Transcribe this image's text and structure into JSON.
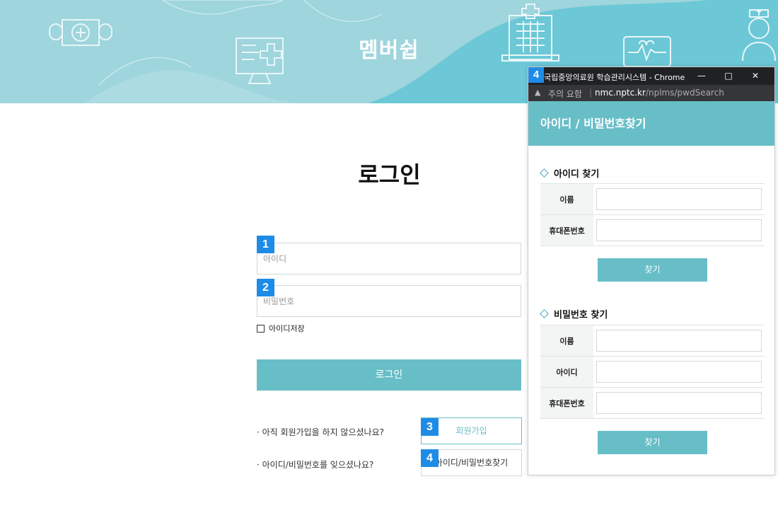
{
  "banner": {
    "title": "멤버쉽"
  },
  "login": {
    "title": "로그인",
    "id_placeholder": "아이디",
    "pw_placeholder": "비밀번호",
    "remember_label": "아이디저장",
    "submit_label": "로그인",
    "signup_question": "· 아직 회원가입을 하지 않으셨나요?",
    "signup_button": "회원가입",
    "find_question": "· 아이디/비밀번호를 잊으셨나요?",
    "find_button": "아이디/비밀번호찾기"
  },
  "badges": {
    "b1": "1",
    "b2": "2",
    "b3": "3",
    "b4": "4",
    "b4_popup": "4"
  },
  "popup": {
    "window_title": "국립중앙의료원 학습관리시스템 - Chrome",
    "security_label": "주의 요함",
    "url_domain": "nmc.nptc.kr",
    "url_path": "/nplms/pwdSearch",
    "header": "아이디 / 비밀번호찾기",
    "find_id": {
      "title": "아이디 찾기",
      "name_label": "이름",
      "phone_label": "휴대폰번호",
      "button": "찾기"
    },
    "find_pw": {
      "title": "비밀번호 찾기",
      "name_label": "이름",
      "id_label": "아이디",
      "phone_label": "휴대폰번호",
      "button": "찾기"
    }
  },
  "icons": [
    "medicine-bottle-icon",
    "monitor-plus-icon",
    "hospital-building-icon",
    "heart-monitor-icon",
    "nurse-icon",
    "warning-icon",
    "minimize-icon",
    "maximize-icon",
    "close-icon",
    "diamond-bullet-icon"
  ],
  "colors": {
    "accent": "#68bec7",
    "banner": "#9fd5dc",
    "badge": "#1e8ce6"
  }
}
